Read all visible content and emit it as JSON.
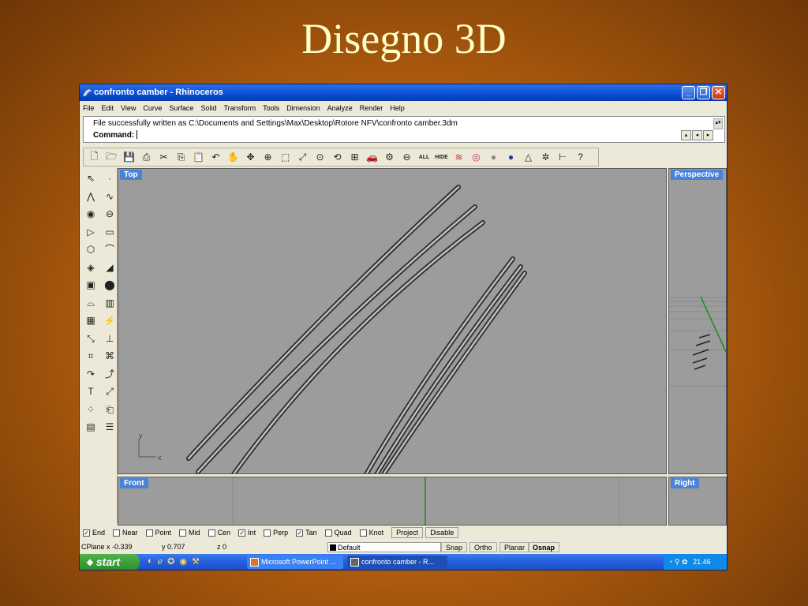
{
  "slide": {
    "title": "Disegno 3D"
  },
  "window": {
    "title": "confronto camber - Rhinoceros",
    "controls": {
      "minimize": "_",
      "maximize": "❐",
      "close": "✕"
    }
  },
  "menu": [
    "File",
    "Edit",
    "View",
    "Curve",
    "Surface",
    "Solid",
    "Transform",
    "Tools",
    "Dimension",
    "Analyze",
    "Render",
    "Help"
  ],
  "command": {
    "history": "File successfully written as C:\\Documents and Settings\\Max\\Desktop\\Rotore NFV\\confronto camber.3dm",
    "prompt": "Command:"
  },
  "toolbar_text": {
    "all": "ALL",
    "hide": "HIDE"
  },
  "viewports": {
    "top": {
      "label": "Top",
      "axis_y": "y",
      "axis_x": "x"
    },
    "perspective": {
      "label": "Perspective"
    },
    "front": {
      "label": "Front"
    },
    "right": {
      "label": "Right"
    }
  },
  "osnap": {
    "options": [
      {
        "label": "End",
        "checked": true
      },
      {
        "label": "Near",
        "checked": false
      },
      {
        "label": "Point",
        "checked": false
      },
      {
        "label": "Mid",
        "checked": false
      },
      {
        "label": "Cen",
        "checked": false
      },
      {
        "label": "Int",
        "checked": true
      },
      {
        "label": "Perp",
        "checked": false
      },
      {
        "label": "Tan",
        "checked": true
      },
      {
        "label": "Quad",
        "checked": false
      },
      {
        "label": "Knot",
        "checked": false
      }
    ],
    "project_label": "Project",
    "disable_label": "Disable"
  },
  "status": {
    "cplane": "CPlane",
    "x": "x -0.339",
    "y": "y 0.707",
    "z": "z 0",
    "layer": "Default",
    "snap": "Snap",
    "ortho": "Ortho",
    "planar": "Planar",
    "osnap": "Osnap"
  },
  "taskbar": {
    "start": "start",
    "tasks": [
      "Microsoft PowerPoint ...",
      "confronto camber - R..."
    ],
    "clock": "21.46"
  },
  "colors": {
    "viewport_bg": "#9c9c9c",
    "active_label": "#4a82d8",
    "titlebar": "#0a4ed6",
    "slide_title": "#ffffc8"
  }
}
